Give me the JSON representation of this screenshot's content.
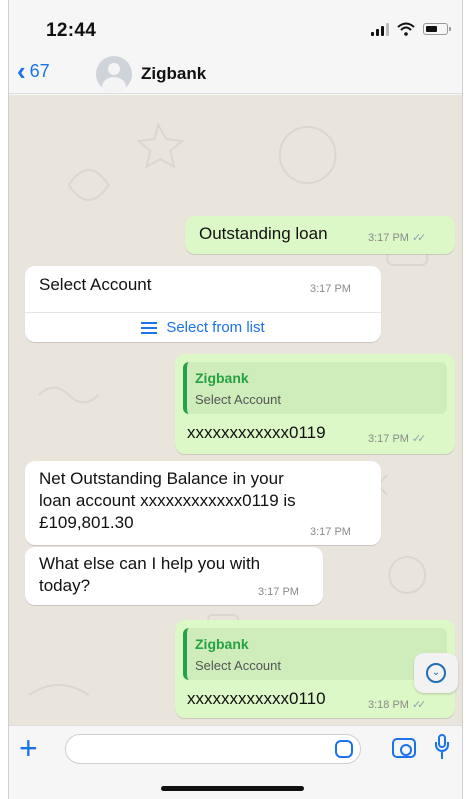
{
  "status_bar": {
    "time": "12:44"
  },
  "header": {
    "back_count": "67",
    "contact_name": "Zigbank"
  },
  "messages": [
    {
      "dir": "out",
      "text": "Outstanding loan",
      "time": "3:17 PM"
    },
    {
      "dir": "in",
      "text": "Select Account",
      "time": "3:17 PM",
      "list_button": "Select from list"
    },
    {
      "dir": "out",
      "quote_name": "Zigbank",
      "quote_text": "Select Account",
      "text": "xxxxxxxxxxxx0119",
      "time": "3:17 PM"
    },
    {
      "dir": "in",
      "lines": [
        "Net Outstanding Balance in your",
        "loan account xxxxxxxxxxxx0119 is",
        "£109,801.30"
      ],
      "time": "3:17 PM"
    },
    {
      "dir": "in",
      "lines": [
        "What else can I help you with",
        "today?"
      ],
      "time": "3:17 PM"
    },
    {
      "dir": "out",
      "quote_name": "Zigbank",
      "quote_text": "Select Account",
      "text": "xxxxxxxxxxxx0110",
      "time": "3:18 PM"
    }
  ],
  "composer": {
    "value": "",
    "placeholder": ""
  },
  "icons": {
    "back": "chevron-left-icon",
    "avatar": "person-icon",
    "plus": "plus-icon",
    "sticker": "sticker-icon",
    "camera": "camera-icon",
    "mic": "microphone-icon",
    "scroll": "chevron-down-icon"
  },
  "colors": {
    "accent": "#1a73e8",
    "outgoing_bubble": "#dcf8c6",
    "incoming_bubble": "#ffffff",
    "quote_author": "#25a244",
    "chat_background": "#e9e4dc"
  }
}
